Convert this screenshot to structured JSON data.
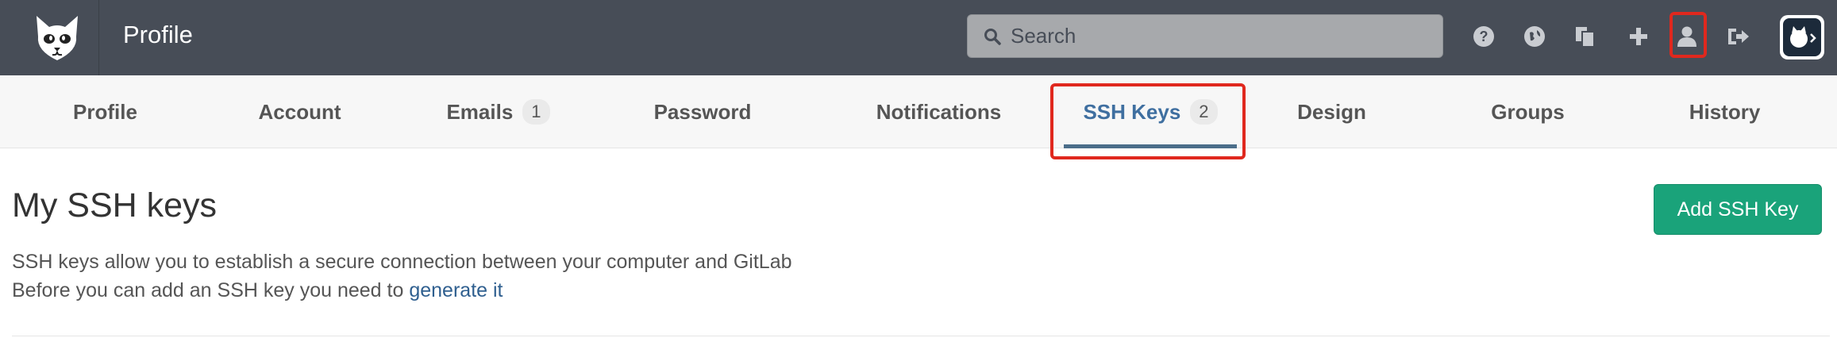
{
  "header": {
    "title": "Profile",
    "search_placeholder": "Search",
    "icons": [
      "help-icon",
      "globe-icon",
      "copy-icon",
      "plus-icon",
      "user-icon",
      "sign-out-icon"
    ],
    "logo": "gitlab-cat-logo"
  },
  "tabs": [
    {
      "label": "Profile"
    },
    {
      "label": "Account"
    },
    {
      "label": "Emails",
      "badge": "1"
    },
    {
      "label": "Password"
    },
    {
      "label": "Notifications"
    },
    {
      "label": "SSH Keys",
      "badge": "2",
      "active": true
    },
    {
      "label": "Design"
    },
    {
      "label": "Groups"
    },
    {
      "label": "History"
    }
  ],
  "main": {
    "title": "My SSH keys",
    "add_button": "Add SSH Key",
    "line1": "SSH keys allow you to establish a secure connection between your computer and GitLab",
    "line2_prefix": "Before you can add an SSH key you need to ",
    "line2_link": "generate it"
  },
  "colors": {
    "header_bg": "#474d57",
    "active_tab": "#3f6fa0",
    "button_green": "#1aa37a",
    "highlight_red": "#e0281e"
  }
}
